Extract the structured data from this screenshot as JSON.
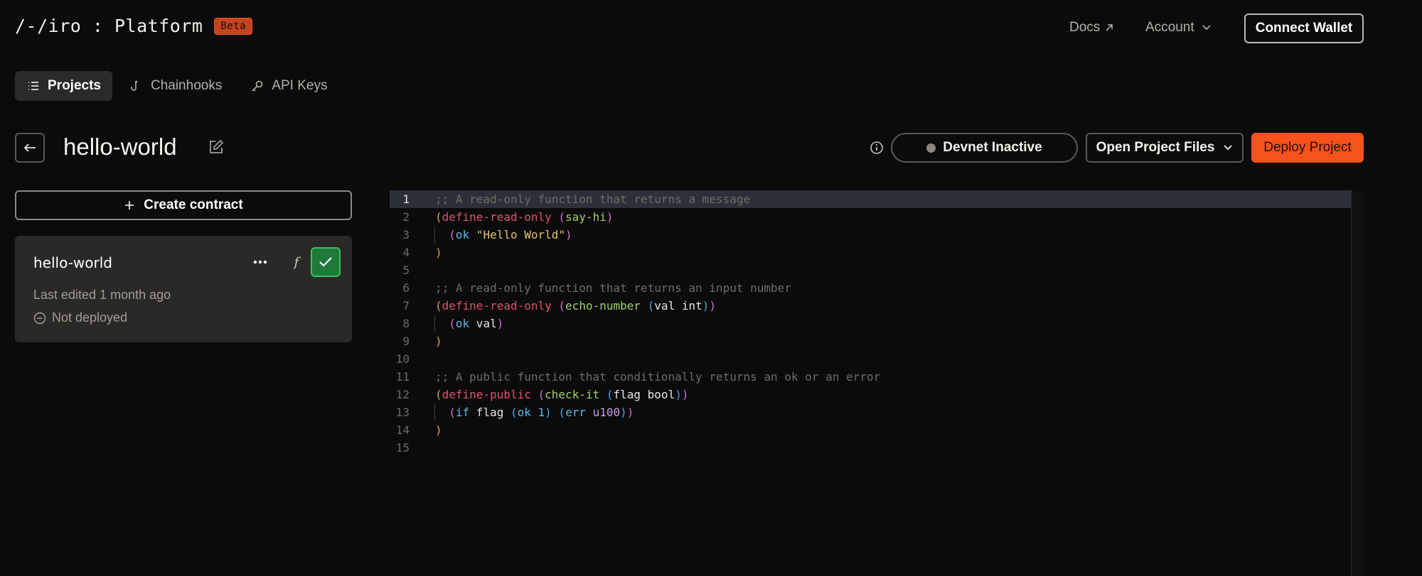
{
  "header": {
    "logo": "/-/iro : Platform",
    "beta": "Beta",
    "docs": "Docs",
    "account": "Account",
    "connect_wallet": "Connect Wallet"
  },
  "tabs": [
    {
      "label": "Projects",
      "icon": "list-icon",
      "active": true
    },
    {
      "label": "Chainhooks",
      "icon": "hook-icon",
      "active": false
    },
    {
      "label": "API Keys",
      "icon": "key-icon",
      "active": false
    }
  ],
  "project": {
    "title": "hello-world",
    "devnet_status": "Devnet Inactive",
    "open_files": "Open Project Files",
    "deploy": "Deploy Project"
  },
  "contracts": {
    "create_label": "Create contract",
    "items": [
      {
        "name": "hello-world",
        "edited": "Last edited 1 month ago",
        "status": "Not deployed",
        "fn_label": "f"
      }
    ]
  },
  "editor": {
    "current_line": 1,
    "lines": [
      [
        {
          "t": ";; A read-only function that returns a message",
          "c": "comment"
        }
      ],
      [
        {
          "t": "(",
          "c": "p1"
        },
        {
          "t": "define-read-only",
          "c": "kw"
        },
        {
          "t": " ",
          "c": "txt"
        },
        {
          "t": "(",
          "c": "p2"
        },
        {
          "t": "say-hi",
          "c": "fn"
        },
        {
          "t": ")",
          "c": "p2"
        }
      ],
      [
        {
          "t": "  ",
          "c": "txt"
        },
        {
          "t": "(",
          "c": "p2"
        },
        {
          "t": "ok",
          "c": "ok"
        },
        {
          "t": " ",
          "c": "txt"
        },
        {
          "t": "\"Hello World\"",
          "c": "str"
        },
        {
          "t": ")",
          "c": "p2"
        }
      ],
      [
        {
          "t": ")",
          "c": "p1"
        }
      ],
      [],
      [
        {
          "t": ";; A read-only function that returns an input number",
          "c": "comment"
        }
      ],
      [
        {
          "t": "(",
          "c": "p1"
        },
        {
          "t": "define-read-only",
          "c": "kw"
        },
        {
          "t": " ",
          "c": "txt"
        },
        {
          "t": "(",
          "c": "p2"
        },
        {
          "t": "echo-number",
          "c": "fn"
        },
        {
          "t": " ",
          "c": "txt"
        },
        {
          "t": "(",
          "c": "p3"
        },
        {
          "t": "val int",
          "c": "txt"
        },
        {
          "t": ")",
          "c": "p3"
        },
        {
          "t": ")",
          "c": "p2"
        }
      ],
      [
        {
          "t": "  ",
          "c": "txt"
        },
        {
          "t": "(",
          "c": "p2"
        },
        {
          "t": "ok",
          "c": "ok"
        },
        {
          "t": " val",
          "c": "txt"
        },
        {
          "t": ")",
          "c": "p2"
        }
      ],
      [
        {
          "t": ")",
          "c": "p1"
        }
      ],
      [],
      [
        {
          "t": ";; A public function that conditionally returns an ok or an error",
          "c": "comment"
        }
      ],
      [
        {
          "t": "(",
          "c": "p1"
        },
        {
          "t": "define-public",
          "c": "kw"
        },
        {
          "t": " ",
          "c": "txt"
        },
        {
          "t": "(",
          "c": "p2"
        },
        {
          "t": "check-it",
          "c": "fn"
        },
        {
          "t": " ",
          "c": "txt"
        },
        {
          "t": "(",
          "c": "p3"
        },
        {
          "t": "flag bool",
          "c": "txt"
        },
        {
          "t": ")",
          "c": "p3"
        },
        {
          "t": ")",
          "c": "p2"
        }
      ],
      [
        {
          "t": "  ",
          "c": "txt"
        },
        {
          "t": "(",
          "c": "p2"
        },
        {
          "t": "if",
          "c": "ok"
        },
        {
          "t": " flag ",
          "c": "txt"
        },
        {
          "t": "(",
          "c": "p3"
        },
        {
          "t": "ok",
          "c": "ok"
        },
        {
          "t": " 1",
          "c": "ok"
        },
        {
          "t": ")",
          "c": "p3"
        },
        {
          "t": " ",
          "c": "txt"
        },
        {
          "t": "(",
          "c": "p3"
        },
        {
          "t": "err",
          "c": "ok"
        },
        {
          "t": " ",
          "c": "txt"
        },
        {
          "t": "u100",
          "c": "num"
        },
        {
          "t": ")",
          "c": "p3"
        },
        {
          "t": ")",
          "c": "p2"
        }
      ],
      [
        {
          "t": ")",
          "c": "p1"
        }
      ],
      []
    ]
  },
  "colors": {
    "accent": "#f5521d",
    "beta_bg": "#c7421e",
    "success": "#1f7a39",
    "background": "#0b0b0b"
  }
}
